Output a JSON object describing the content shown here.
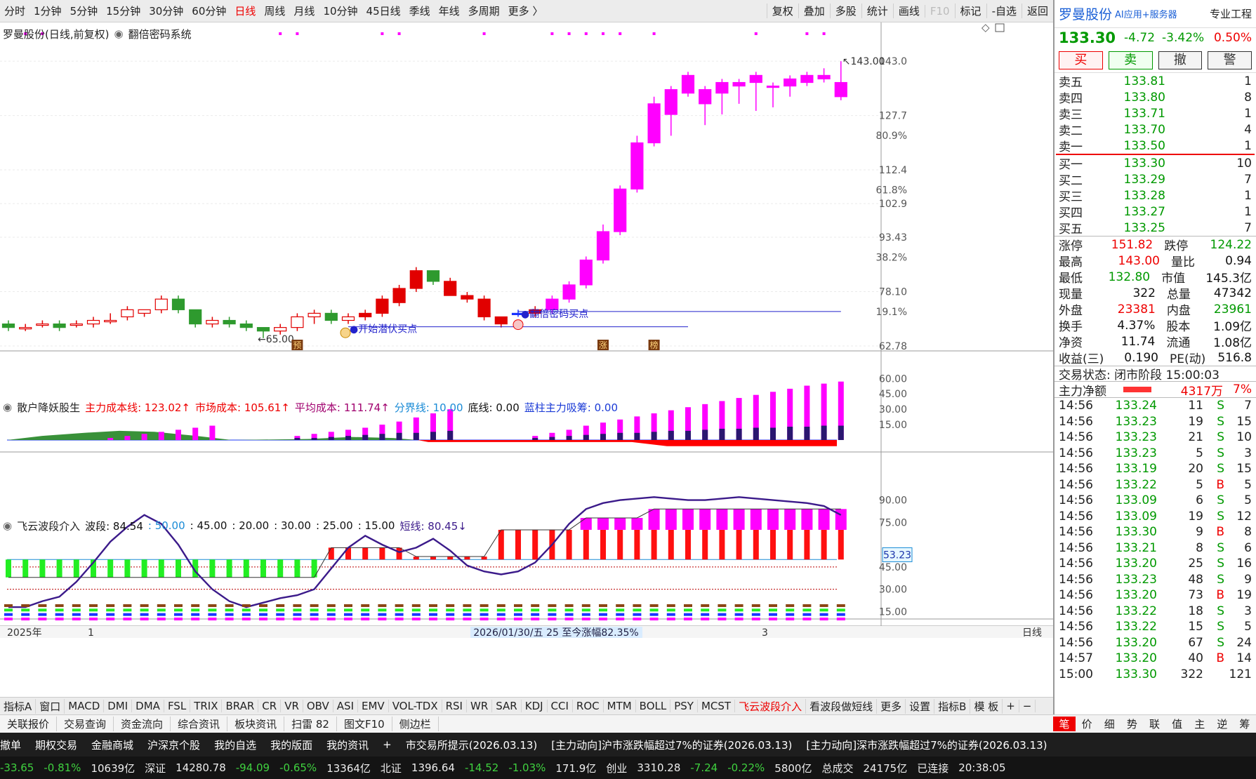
{
  "topbar": {
    "tabs": [
      "分时",
      "1分钟",
      "5分钟",
      "15分钟",
      "30分钟",
      "60分钟",
      "日线",
      "周线",
      "月线",
      "10分钟",
      "45日线",
      "季线",
      "年线",
      "多周期",
      "更多 〉"
    ],
    "active_index": 6,
    "right": [
      "复权",
      "叠加",
      "多股",
      "统计",
      "画线",
      "F10",
      "标记",
      "-自选",
      "返回"
    ]
  },
  "chart": {
    "title": "罗曼股份(日线,前复权)",
    "system": "翻倍密码系统",
    "high_label": "143.00",
    "low_label": "65.00",
    "signal_buy": "翻倍密码买点",
    "signal_start": "开始潜伏买点",
    "marker_yu": "预",
    "marker_zhang": "涨",
    "marker_bang": "榜",
    "price_axis": [
      "143.0",
      "127.7",
      "112.4",
      "102.9",
      "93.43",
      "78.10",
      "62.78"
    ],
    "pct_axis": [
      "80.9%",
      "61.8%",
      "38.2%",
      "19.1%"
    ]
  },
  "ind1": {
    "name": "散户降妖股生",
    "items": [
      {
        "t": "主力成本线: 123.02↑",
        "c": "#e00"
      },
      {
        "t": "市场成本: 105.61↑",
        "c": "#e00"
      },
      {
        "t": "平均成本: 111.74↑",
        "c": "#a0006e"
      },
      {
        "t": "分界线: 10.00",
        "c": "#1a8bd6"
      },
      {
        "t": "底线: 0.00",
        "c": "#111"
      },
      {
        "t": "蓝柱主力吸筹: 0.00",
        "c": "#1a3ad6"
      }
    ],
    "axis": [
      "60.00",
      "45.00",
      "30.00",
      "15.00"
    ]
  },
  "ind2": {
    "name": "飞云波段介入",
    "items": [
      {
        "t": "波段: 84.54",
        "c": "#111"
      },
      {
        "t": ": 50.00",
        "c": "#1a8bd6"
      },
      {
        "t": ": 45.00",
        "c": "#111"
      },
      {
        "t": ": 20.00",
        "c": "#111"
      },
      {
        "t": ": 30.00",
        "c": "#111"
      },
      {
        "t": ": 25.00",
        "c": "#111"
      },
      {
        "t": ": 15.00",
        "c": "#111"
      },
      {
        "t": "短线: 80.45↓",
        "c": "#3b1a8a"
      }
    ],
    "axis": [
      "90.00",
      "75.00",
      "45.00",
      "30.00",
      "15.00"
    ],
    "cursor_value": "53.23"
  },
  "dateaxis": {
    "year": "2025年",
    "m1": "1",
    "m3": "3",
    "range_text": "2026/01/30/五 25 至今涨幅82.35%",
    "period": "日线"
  },
  "bottomtabs": [
    "指标A",
    "窗口",
    "MACD",
    "DMI",
    "DMA",
    "FSL",
    "TRIX",
    "BRAR",
    "CR",
    "VR",
    "OBV",
    "ASI",
    "EMV",
    "VOL-TDX",
    "RSI",
    "WR",
    "SAR",
    "KDJ",
    "CCI",
    "ROC",
    "MTM",
    "BOLL",
    "PSY",
    "MCST",
    "飞云波段介入",
    "看波段做短线",
    "更多",
    "设置",
    "指标B",
    "模 板",
    "+",
    "−"
  ],
  "linkbar": [
    "关联报价",
    "交易查询",
    "资金流向",
    "综合资讯",
    "板块资讯",
    "扫雷 82",
    "图文F10",
    "侧边栏"
  ],
  "quote": {
    "name": "罗曼股份",
    "extra": "AI应用+服务器",
    "price": "133.30",
    "change": "-4.72",
    "change_pct": "-3.42%",
    "pro_label": "专业工程",
    "pro_pct": "0.50%",
    "buttons": [
      "买",
      "卖",
      "撤",
      "警"
    ],
    "asks": [
      [
        "卖五",
        "133.81",
        "1"
      ],
      [
        "卖四",
        "133.80",
        "8"
      ],
      [
        "卖三",
        "133.71",
        "1"
      ],
      [
        "卖二",
        "133.70",
        "4"
      ],
      [
        "卖一",
        "133.50",
        "1"
      ]
    ],
    "bids": [
      [
        "买一",
        "133.30",
        "10"
      ],
      [
        "买二",
        "133.29",
        "7"
      ],
      [
        "买三",
        "133.28",
        "1"
      ],
      [
        "买四",
        "133.27",
        "1"
      ],
      [
        "买五",
        "133.25",
        "7"
      ]
    ],
    "stats": [
      [
        "涨停",
        "151.82",
        "跌停",
        "124.22"
      ],
      [
        "最高",
        "143.00",
        "量比",
        "0.94"
      ],
      [
        "最低",
        "132.80",
        "市值",
        "145.3亿"
      ],
      [
        "现量",
        "322",
        "总量",
        "47342"
      ],
      [
        "外盘",
        "23381",
        "内盘",
        "23961"
      ],
      [
        "换手",
        "4.37%",
        "股本",
        "1.09亿"
      ],
      [
        "净资",
        "11.74",
        "流通",
        "1.08亿"
      ],
      [
        "收益(三)",
        "0.190",
        "PE(动)",
        "516.8"
      ]
    ],
    "status": "交易状态: 闭市阶段 15:00:03",
    "net_label": "主力净额",
    "net_value": "4317万",
    "net_pct": "7%",
    "ticks": [
      [
        "14:56",
        "133.24",
        "11",
        "S",
        "7"
      ],
      [
        "14:56",
        "133.23",
        "19",
        "S",
        "15"
      ],
      [
        "14:56",
        "133.23",
        "21",
        "S",
        "10"
      ],
      [
        "14:56",
        "133.23",
        "5",
        "S",
        "3"
      ],
      [
        "14:56",
        "133.19",
        "20",
        "S",
        "15"
      ],
      [
        "14:56",
        "133.22",
        "5",
        "B",
        "5"
      ],
      [
        "14:56",
        "133.09",
        "6",
        "S",
        "5"
      ],
      [
        "14:56",
        "133.09",
        "19",
        "S",
        "12"
      ],
      [
        "14:56",
        "133.30",
        "9",
        "B",
        "8"
      ],
      [
        "14:56",
        "133.21",
        "8",
        "S",
        "6"
      ],
      [
        "14:56",
        "133.20",
        "25",
        "S",
        "16"
      ],
      [
        "14:56",
        "133.23",
        "48",
        "S",
        "9"
      ],
      [
        "14:56",
        "133.20",
        "73",
        "B",
        "19"
      ],
      [
        "14:56",
        "133.22",
        "18",
        "S",
        "3"
      ],
      [
        "14:56",
        "133.22",
        "15",
        "S",
        "5"
      ],
      [
        "14:56",
        "133.20",
        "67",
        "S",
        "24"
      ],
      [
        "14:57",
        "133.20",
        "40",
        "B",
        "14"
      ],
      [
        "15:00",
        "133.30",
        "322",
        "",
        "121"
      ]
    ]
  },
  "rtabs": [
    "笔",
    "价",
    "细",
    "势",
    "联",
    "值",
    "主",
    "逆",
    "筹"
  ],
  "taskbar": [
    "撤单",
    "期权交易",
    "金融商城",
    "沪深京个股",
    "我的自选",
    "我的版面",
    "我的资讯",
    "+",
    "市交易所提示(2026.03.13)",
    "[主力动向]沪市涨跌幅超过7%的证券(2026.03.13)",
    "[主力动向]深市涨跌幅超过7%的证券(2026.03.13)"
  ],
  "ticker": [
    "-33.65",
    "-0.81%",
    "10639亿",
    "深证",
    "14280.78",
    "-94.09",
    "-0.65%",
    "13364亿",
    "北证",
    "1396.64",
    "-14.52",
    "-1.03%",
    "171.9亿",
    "创业",
    "3310.28",
    "-7.24",
    "-0.22%",
    "5800亿",
    "总成交",
    "24175亿",
    "已连接",
    "20:38:05"
  ],
  "candles": [
    [
      69,
      68,
      70,
      67
    ],
    [
      68,
      68,
      69,
      67
    ],
    [
      69,
      69,
      70,
      68
    ],
    [
      69,
      68,
      70,
      67
    ],
    [
      69,
      69,
      70,
      68
    ],
    [
      69,
      70,
      71,
      68
    ],
    [
      70,
      70,
      72,
      69
    ],
    [
      71,
      73,
      74,
      70
    ],
    [
      72,
      73,
      73,
      71
    ],
    [
      73,
      76,
      77,
      72
    ],
    [
      76,
      73,
      77,
      72
    ],
    [
      73,
      69,
      73,
      68
    ],
    [
      69,
      70,
      71,
      68
    ],
    [
      70,
      69,
      71,
      68
    ],
    [
      69,
      68,
      70,
      67
    ],
    [
      68,
      67,
      68,
      65
    ],
    [
      67,
      68,
      69,
      66
    ],
    [
      68,
      71,
      72,
      67
    ],
    [
      71,
      72,
      73,
      69
    ],
    [
      72,
      70,
      73,
      69
    ],
    [
      70,
      71,
      72,
      69
    ],
    [
      71,
      72,
      73,
      70
    ],
    [
      72,
      76,
      77,
      71
    ],
    [
      75,
      79,
      80,
      74
    ],
    [
      79,
      84,
      85,
      78
    ],
    [
      84,
      81,
      84,
      80
    ],
    [
      81,
      77,
      82,
      77
    ],
    [
      77,
      76,
      78,
      75
    ],
    [
      76,
      71,
      77,
      70
    ],
    [
      71,
      69,
      71,
      68
    ],
    [
      72,
      72,
      73,
      71
    ],
    [
      72,
      73,
      74,
      71
    ],
    [
      73,
      76,
      77,
      72
    ],
    [
      76,
      80,
      81,
      75
    ],
    [
      80,
      87,
      88,
      79
    ],
    [
      87,
      95,
      97,
      86
    ],
    [
      95,
      107,
      108,
      94
    ],
    [
      107,
      120,
      122,
      106
    ],
    [
      120,
      131,
      133,
      119
    ],
    [
      128,
      135,
      136,
      122
    ],
    [
      134,
      139,
      140,
      133
    ],
    [
      131,
      135,
      136,
      125
    ],
    [
      134,
      137,
      138,
      128
    ],
    [
      136,
      137,
      138,
      131
    ],
    [
      137,
      139,
      140,
      129
    ],
    [
      136,
      136,
      137,
      130
    ],
    [
      136,
      138,
      139,
      133
    ],
    [
      137,
      139,
      140,
      136
    ],
    [
      139,
      138,
      141,
      137
    ],
    [
      133,
      137,
      143,
      132
    ]
  ]
}
